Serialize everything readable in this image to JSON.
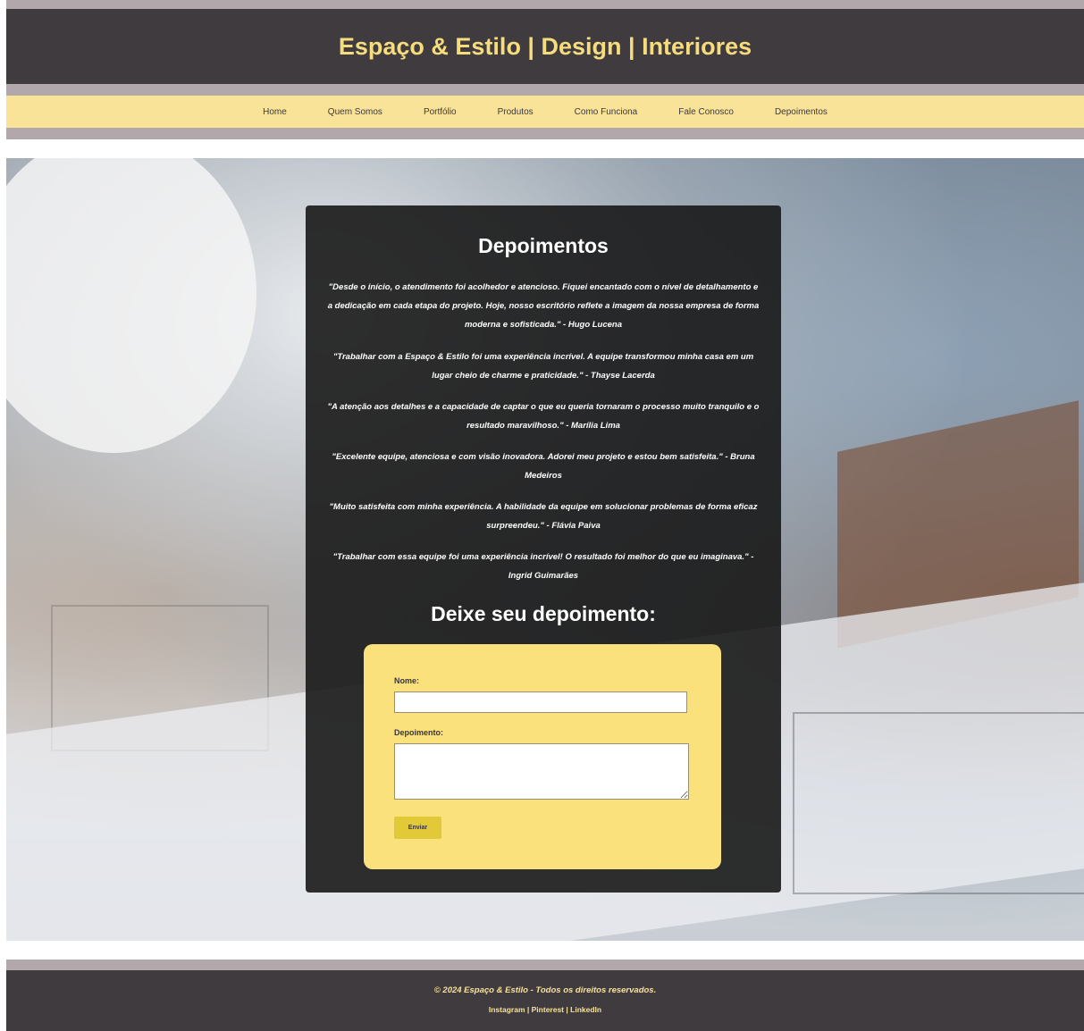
{
  "header": {
    "title": "Espaço & Estilo | Design | Interiores"
  },
  "nav": {
    "items": [
      {
        "label": "Home"
      },
      {
        "label": "Quem Somos"
      },
      {
        "label": "Portfólio"
      },
      {
        "label": "Produtos"
      },
      {
        "label": "Como Funciona"
      },
      {
        "label": "Fale Conosco"
      },
      {
        "label": "Depoimentos"
      }
    ]
  },
  "testimonials": {
    "title": "Depoimentos",
    "items": [
      "\"Desde o início, o atendimento foi acolhedor e atencioso. Fiquei encantado com o nível de detalhamento e a dedicação em cada etapa do projeto. Hoje, nosso escritório reflete a imagem da nossa empresa de forma moderna e sofisticada.\" - Hugo Lucena",
      "\"Trabalhar com a Espaço & Estilo foi uma experiência incrível. A equipe transformou minha casa em um lugar cheio de charme e praticidade.\" - Thayse Lacerda",
      "\"A atenção aos detalhes e a capacidade de captar o que eu queria tornaram o processo muito tranquilo e o resultado maravilhoso.\" - Marília Lima",
      "\"Excelente equipe, atenciosa e com visão inovadora. Adorei meu projeto e estou bem satisfeita.\" - Bruna Medeiros",
      "\"Muito satisfeita com minha experiência. A habilidade da equipe em solucionar problemas de forma eficaz surpreendeu.\" - Flávia Paiva",
      "\"Trabalhar com essa equipe foi uma experiência incrível! O resultado foi melhor do que eu imaginava.\" - Ingrid Guimarães"
    ]
  },
  "form": {
    "heading": "Deixe seu depoimento:",
    "name_label": "Nome:",
    "name_value": "",
    "testimonial_label": "Depoimento:",
    "testimonial_value": "",
    "submit_label": "Enviar"
  },
  "footer": {
    "copyright": "© 2024 Espaço & Estilo - Todos os direitos reservados.",
    "links": [
      {
        "label": "Instagram"
      },
      {
        "label": "Pinterest"
      },
      {
        "label": "LinkedIn"
      }
    ],
    "separator": "|"
  },
  "colors": {
    "header_bg": "#403b3f",
    "accent_yellow": "#f5dc7c",
    "nav_bg": "#f9e399",
    "band": "#b2a7ab",
    "form_bg": "#fbe17b",
    "button_bg": "#e2c937"
  }
}
